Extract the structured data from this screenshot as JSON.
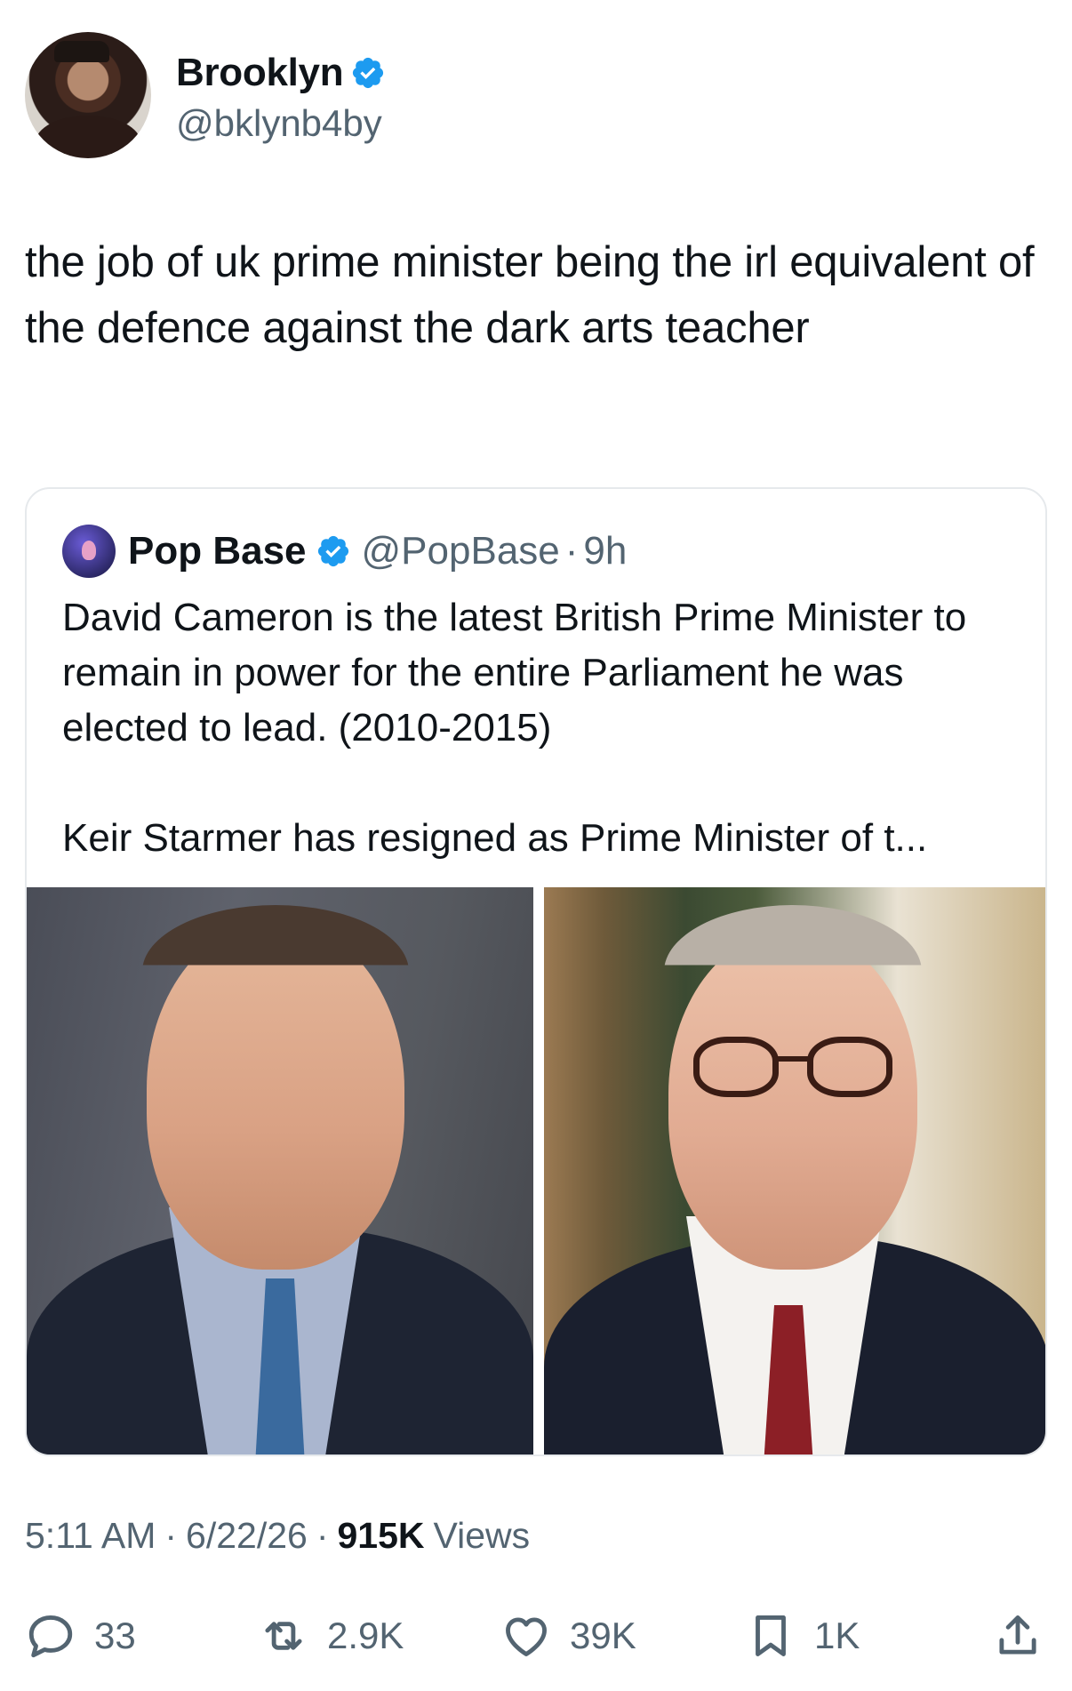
{
  "author": {
    "display_name": "Brooklyn",
    "handle": "@bklynb4by",
    "verified": true
  },
  "tweet": {
    "text": "the job of uk prime minister being the irl equivalent of the defence against the dark arts teacher"
  },
  "quoted": {
    "display_name": "Pop Base",
    "handle": "@PopBase",
    "separator": "·",
    "time": "9h",
    "paragraph1": "David Cameron is the latest British Prime Minister to remain in power for the entire Parliament he was elected to lead. (2010-2015)",
    "paragraph2": "Keir Starmer has resigned as Prime Minister of t..."
  },
  "meta": {
    "time": "5:11 AM",
    "date": "6/22/26",
    "views_count": "915K",
    "views_label": "Views",
    "separator": "·"
  },
  "actions": {
    "replies": "33",
    "retweets": "2.9K",
    "likes": "39K",
    "bookmarks": "1K"
  },
  "colors": {
    "verified_blue": "#1d9bf0",
    "text_primary": "#0f1419",
    "text_secondary": "#536471",
    "border": "#e6e9ec"
  },
  "icons": {
    "reply": "reply-icon",
    "retweet": "retweet-icon",
    "like": "heart-icon",
    "bookmark": "bookmark-icon",
    "share": "share-icon"
  }
}
